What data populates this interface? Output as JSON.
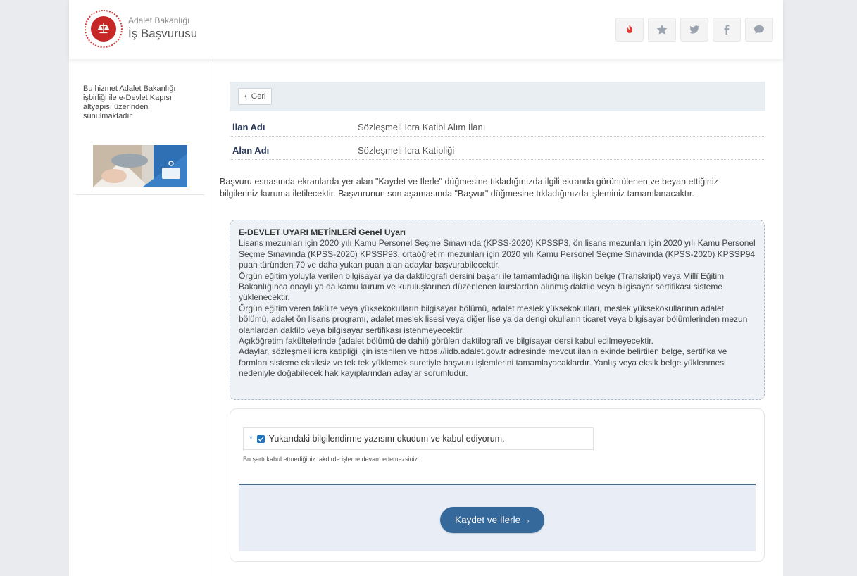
{
  "header": {
    "org_name": "Adalet Bakanlığı",
    "service_name": "İş Başvurusu",
    "actions": [
      "fire-icon",
      "star-icon",
      "twitter-icon",
      "facebook-icon",
      "chat-icon"
    ]
  },
  "sidebar": {
    "text": "Bu hizmet Adalet Bakanlığı işbirliği ile e-Devlet Kapısı altyapısı üzerinden sunulmaktadır."
  },
  "content": {
    "back_label": "Geri",
    "info": [
      {
        "key": "İlan Adı",
        "value": "Sözleşmeli İcra Katibi Alım İlanı"
      },
      {
        "key": "Alan Adı",
        "value": "Sözleşmeli İcra Katipliği"
      }
    ],
    "intro": "Başvuru esnasında ekranlarda yer alan \"Kaydet ve İlerle\" düğmesine tıkladığınızda ilgili ekranda görüntülenen ve beyan ettiğiniz bilgileriniz kuruma iletilecektir. Başvurunun son aşamasında \"Başvur\" düğmesine tıkladığınızda işleminiz tamamlanacaktır.",
    "warning": {
      "title": "E-DEVLET UYARI METİNLERİ Genel Uyarı",
      "lines": [
        "Lisans mezunları için 2020 yılı Kamu Personel Seçme Sınavında (KPSS-2020) KPSSP3, ön lisans mezunları için 2020 yılı Kamu Personel Seçme Sınavında (KPSS-2020) KPSSP93, ortaöğretim mezunları için 2020 yılı Kamu Personel Seçme Sınavında (KPSS-2020) KPSSP94 puan türünden 70 ve daha yukarı puan alan adaylar başvurabilecektir.",
        "Örgün eğitim yoluyla verilen bilgisayar ya da daktilografi dersini başarı ile tamamladığına ilişkin belge (Transkript) veya Millî Eğitim Bakanlığınca onaylı ya da kamu kurum ve kuruluşlarınca düzenlenen kurslardan alınmış daktilo veya bilgisayar sertifikası sisteme yüklenecektir.",
        "Örgün eğitim veren fakülte veya yüksekokulların bilgisayar bölümü, adalet meslek yüksekokulları, meslek yüksekokullarının adalet bölümü, adalet ön lisans programı, adalet meslek lisesi veya diğer lise ya da dengi okulların ticaret veya bilgisayar bölümlerinden mezun olanlardan daktilo veya bilgisayar sertifikası istenmeyecektir.",
        "Açıköğretim fakültelerinde (adalet bölümü de dahil) görülen daktilografi ve bilgisayar dersi kabul edilmeyecektir.",
        "Adaylar, sözleşmeli icra katipliği için istenilen ve https://iidb.adalet.gov.tr adresinde mevcut ilanın ekinde belirtilen belge, sertifika ve formları sisteme eksiksiz ve tek tek yüklemek suretiyle başvuru işlemlerini tamamlayacaklardır. Yanlış veya eksik belge yüklenmesi nedeniyle doğabilecek hak kayıplarından adaylar sorumludur."
      ]
    },
    "form": {
      "required_mark": "*",
      "agree_label": "Yukarıdaki bilgilendirme yazısını okudum ve kabul ediyorum.",
      "agree_checked": true,
      "agree_note": "Bu şartı kabul etmediğiniz takdirde işleme devam edemezsiniz.",
      "submit_label": "Kaydet ve İlerle"
    }
  }
}
